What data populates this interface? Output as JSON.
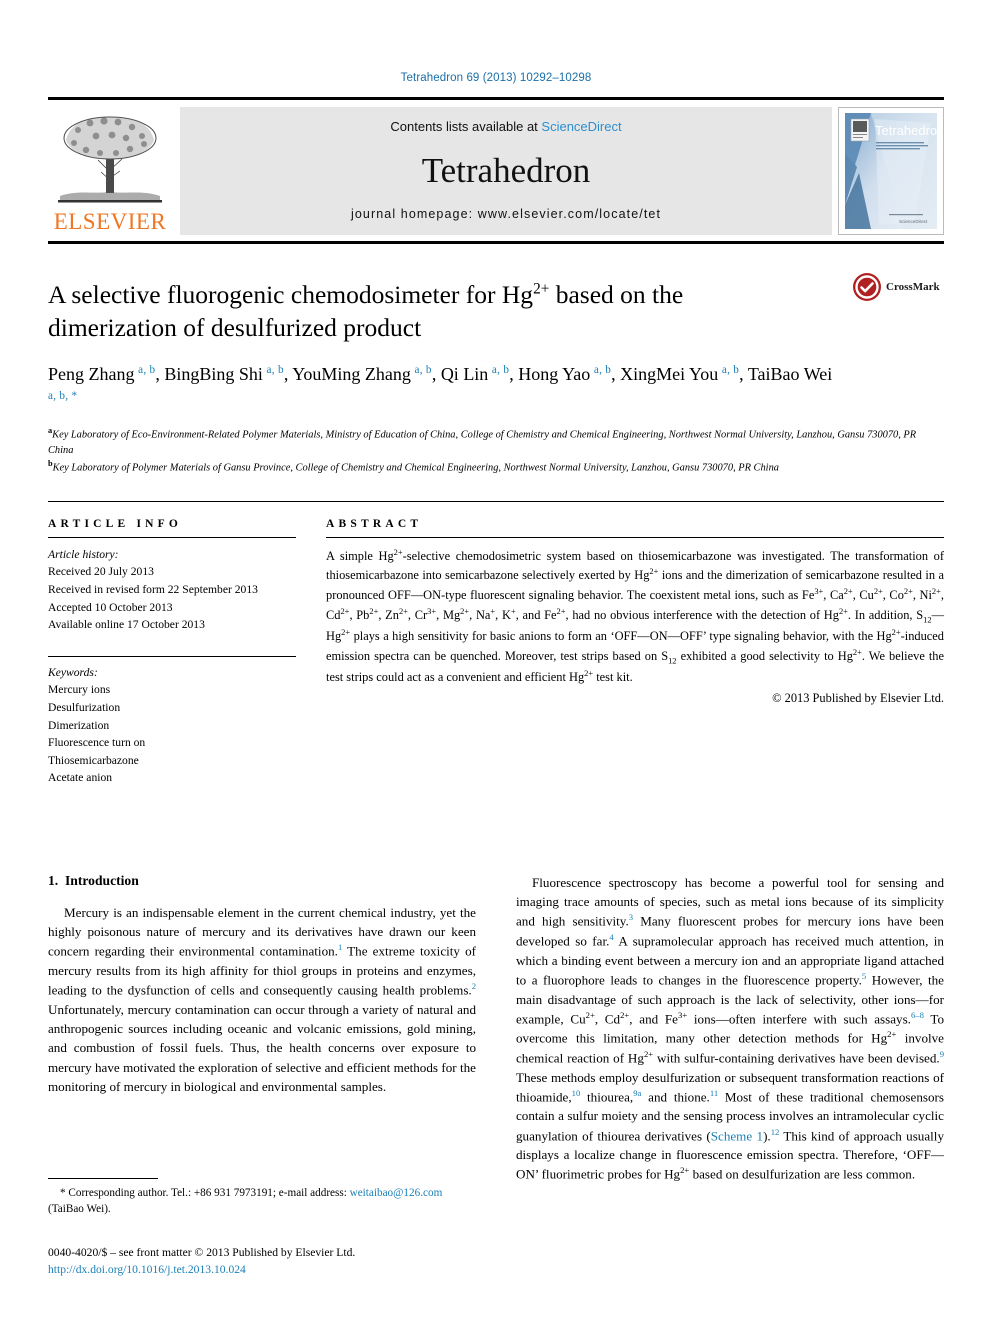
{
  "running_head": "Tetrahedron 69 (2013) 10292–10298",
  "masthead": {
    "publisher_name": "ELSEVIER",
    "contents_prefix": "Contents lists available at ",
    "sciencedirect": "ScienceDirect",
    "journal_name": "Tetrahedron",
    "homepage": "journal homepage: www.elsevier.com/locate/tet",
    "cover_title": "Tetrahedron",
    "cover_sub": "An International Journal for the Rapid Publication of Full Original Research Papers and Critical Reviews in Organic Chemistry",
    "cover_footer": "ScienceDirect"
  },
  "article": {
    "title_line1_pre": "A selective fluorogenic chemodosimeter for Hg",
    "title_sup": "2+",
    "title_line1_post": " based on the",
    "title_line2": "dimerization of desulfurized product",
    "crossmark_label": "CrossMark",
    "authors": [
      {
        "name": "Peng Zhang",
        "sup": "a, b",
        "sep": ", "
      },
      {
        "name": "BingBing Shi",
        "sup": "a, b",
        "sep": ", "
      },
      {
        "name": "YouMing Zhang",
        "sup": "a, b",
        "sep": ", "
      },
      {
        "name": "Qi Lin",
        "sup": "a, b",
        "sep": ", "
      },
      {
        "name": "Hong Yao",
        "sup": "a, b",
        "sep": ", "
      },
      {
        "name": "XingMei You",
        "sup": "a, b",
        "sep": ", "
      },
      {
        "name": "TaiBao Wei",
        "sup": "a, b, *",
        "sep": ""
      }
    ],
    "affiliations": [
      {
        "marker": "a",
        "text": "Key Laboratory of Eco-Environment-Related Polymer Materials, Ministry of Education of China, College of Chemistry and Chemical Engineering, Northwest Normal University, Lanzhou, Gansu 730070, PR China"
      },
      {
        "marker": "b",
        "text": "Key Laboratory of Polymer Materials of Gansu Province, College of Chemistry and Chemical Engineering, Northwest Normal University, Lanzhou, Gansu 730070, PR China"
      }
    ]
  },
  "article_info": {
    "heading": "ARTICLE INFO",
    "history_label": "Article history:",
    "history": [
      "Received 20 July 2013",
      "Received in revised form 22 September 2013",
      "Accepted 10 October 2013",
      "Available online 17 October 2013"
    ],
    "keywords_label": "Keywords:",
    "keywords": [
      "Mercury ions",
      "Desulfurization",
      "Dimerization",
      "Fluorescence turn on",
      "Thiosemicarbazone",
      "Acetate anion"
    ]
  },
  "abstract": {
    "heading": "ABSTRACT",
    "copyright": "© 2013 Published by Elsevier Ltd."
  },
  "introduction": {
    "section_number": "1.",
    "section_title": "Introduction"
  },
  "footnote": {
    "text_pre": "* Corresponding author. Tel.: +86 931 7973191; e-mail address: ",
    "email": "weitaibao@126.com",
    "text_post": " (TaiBao Wei)."
  },
  "footer": {
    "issn_line": "0040-4020/$ – see front matter © 2013 Published by Elsevier Ltd.",
    "doi": "http://dx.doi.org/10.1016/j.tet.2013.10.024"
  },
  "colors": {
    "link": "#1a7fb5",
    "sciencedirect": "#2d8fd0",
    "elsevier_orange": "#ef7622",
    "running_head": "#1a6fa8"
  }
}
